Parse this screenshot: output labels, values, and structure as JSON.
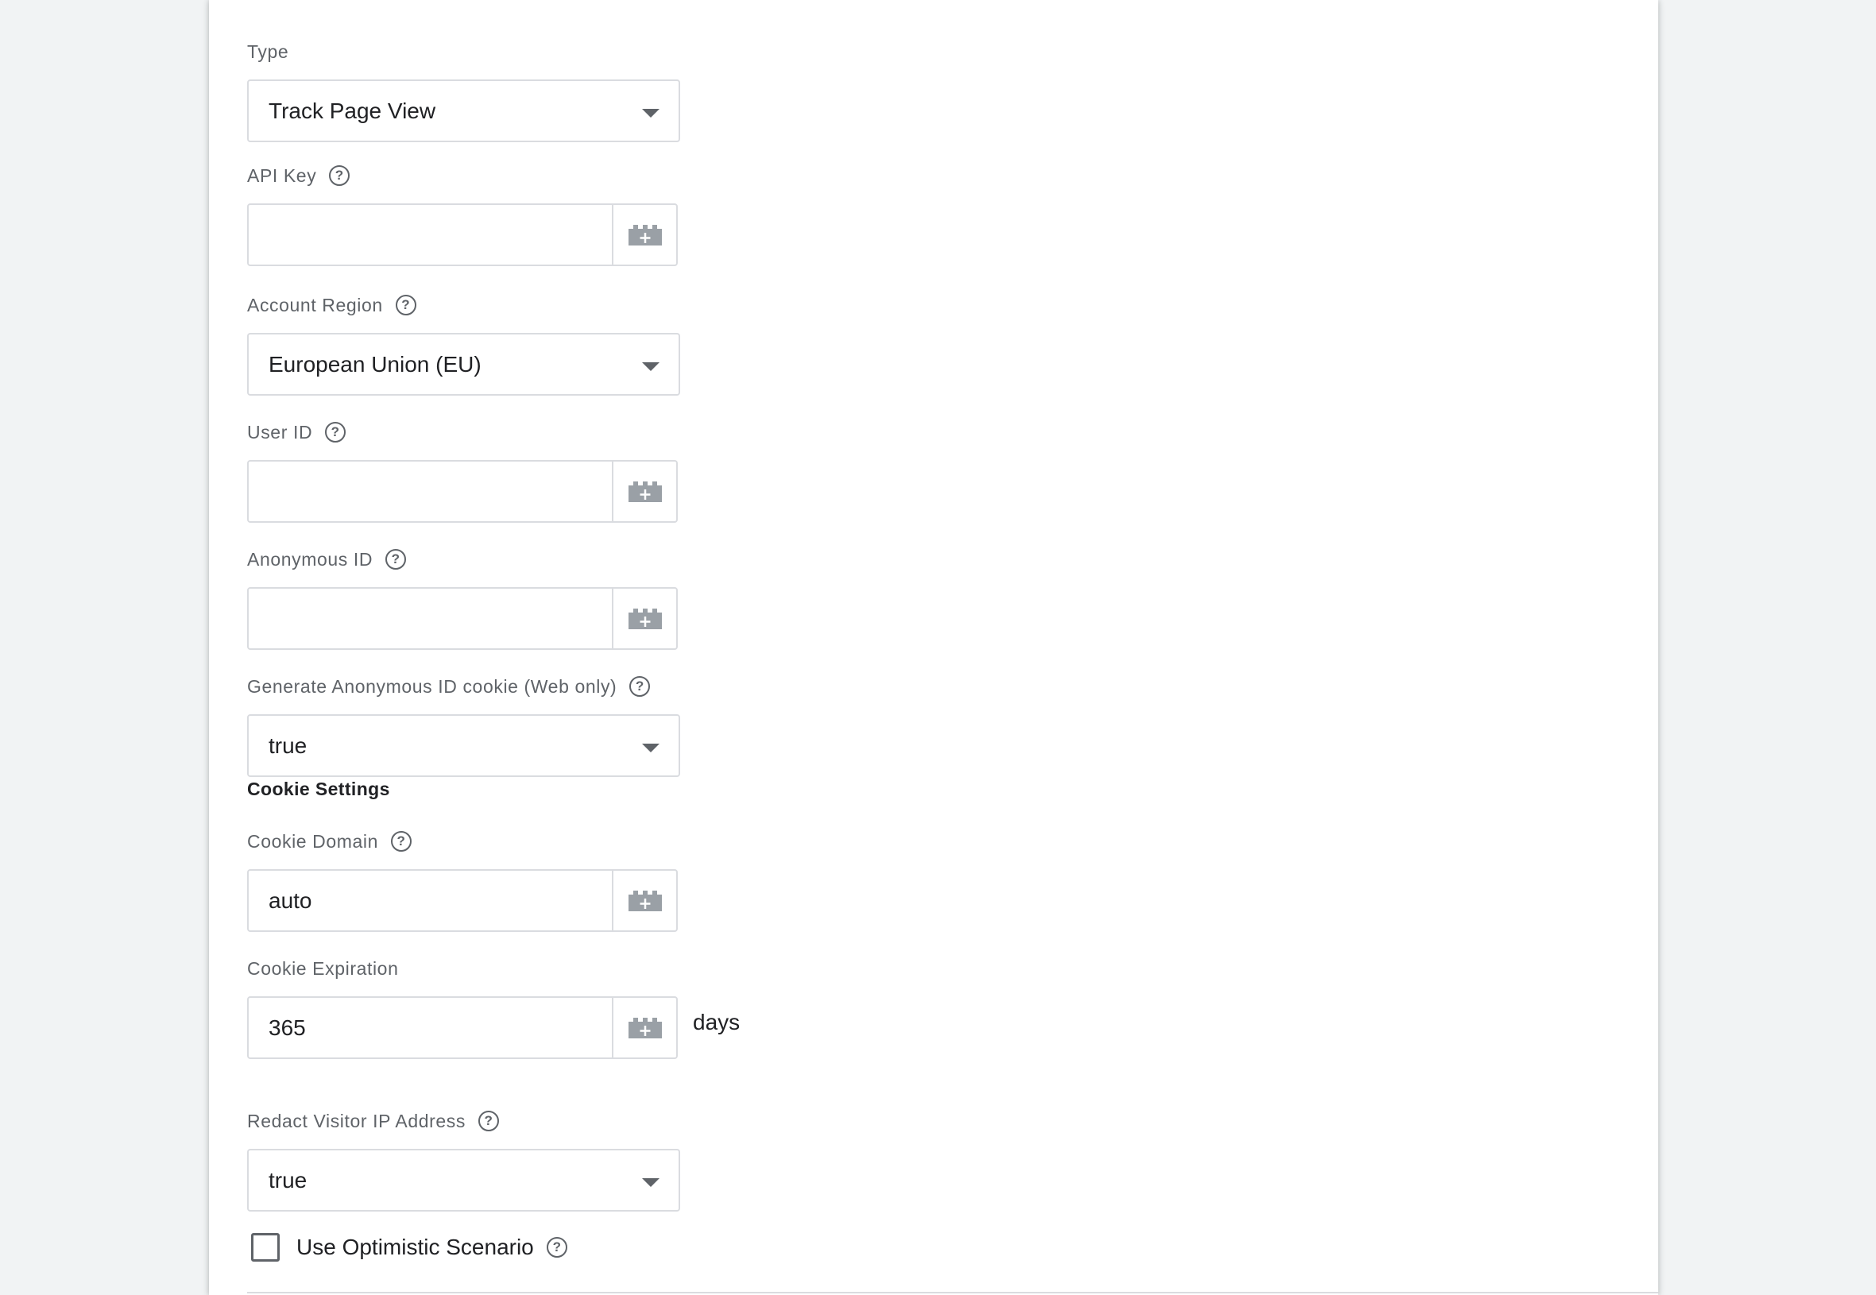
{
  "fields": {
    "type": {
      "label": "Type",
      "value": "Track Page View"
    },
    "api_key": {
      "label": "API Key",
      "value": ""
    },
    "account_region": {
      "label": "Account Region",
      "value": "European Union (EU)"
    },
    "user_id": {
      "label": "User ID",
      "value": ""
    },
    "anonymous_id": {
      "label": "Anonymous ID",
      "value": ""
    },
    "generate_cookie": {
      "label": "Generate Anonymous ID cookie (Web only)",
      "value": "true"
    },
    "cookie_domain": {
      "label": "Cookie Domain",
      "value": "auto"
    },
    "cookie_expiration": {
      "label": "Cookie Expiration",
      "value": "365",
      "suffix": "days"
    },
    "redact_ip": {
      "label": "Redact Visitor IP Address",
      "value": "true"
    }
  },
  "section": {
    "cookie_settings": "Cookie Settings"
  },
  "checkbox": {
    "label": "Use Optimistic Scenario",
    "checked": false
  },
  "icons": {
    "help": "help-circle-icon",
    "variable": "variable-brick-icon",
    "dropdown": "caret-down-icon"
  },
  "glyphs": {
    "help": "?"
  },
  "colors": {
    "background": "#f1f3f4",
    "card": "#ffffff",
    "border": "#dadce0",
    "label": "#5f6368",
    "text": "#202124",
    "icon": "#9aa0a6"
  }
}
